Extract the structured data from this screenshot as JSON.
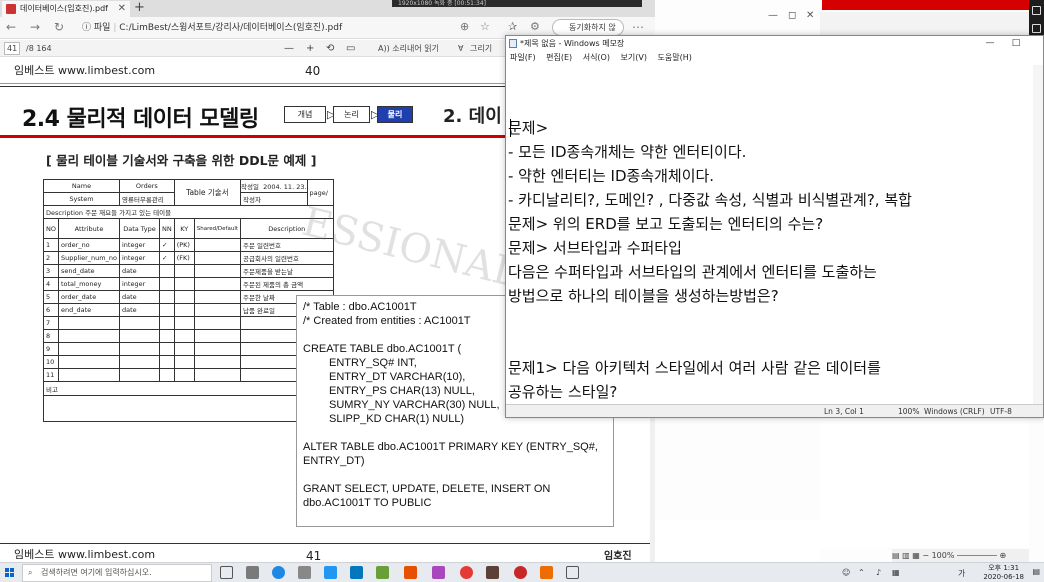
{
  "pdf": {
    "tab_title": "데이터베이스(임호진).pdf",
    "new_tab": "+",
    "url_label": "파일",
    "url": "C:/LimBest/스윙서포트/강리사/데이터베이스(임호진).pdf",
    "profile": "동기화하지 않음",
    "page_current": "41",
    "page_total": "/8 164",
    "zoom_out": "—",
    "zoom_in": "+",
    "read_aloud": "A)) 소리내어 읽기",
    "draw": "그리기",
    "header_brand": "임베스트 www.limbest.com",
    "page_top_number": "40",
    "heading": "2.4  물리적 데이터 모델링",
    "steps": [
      "개념",
      "논리",
      "물리"
    ],
    "heading_right": "2. 데이",
    "subheading": "[ 물리 테이블 기술서와 구축을 위한 DDL문 예제 ]",
    "table": {
      "meta": {
        "name_label": "Name",
        "name_value": "Orders",
        "system_label": "System",
        "system_value": "영류터무롱관리",
        "table_label": "Table 기술서",
        "author_label": "작성일",
        "date_value": "2004. 11. 23.",
        "page_label": "page/",
        "writer_label": "작성자",
        "desc_label": "Description",
        "desc_value": "주문 재요들 가지고 있는 테이블"
      },
      "headers": [
        "NO",
        "Attribute",
        "Data Type",
        "NN",
        "KY",
        "Shared/Default",
        "Description"
      ],
      "rows": [
        [
          "1",
          "order_no",
          "integer",
          "✓",
          "(PK)",
          "",
          "주문 일련번호"
        ],
        [
          "2",
          "Supplier_num_no",
          "integer",
          "✓",
          "(FK)",
          "",
          "공급회사의 일련번호"
        ],
        [
          "3",
          "send_date",
          "date",
          "",
          "",
          "",
          "주문제품을 받는날"
        ],
        [
          "4",
          "total_money",
          "integer",
          "",
          "",
          "",
          "주문된 제품의 총 금액"
        ],
        [
          "5",
          "order_date",
          "date",
          "",
          "",
          "",
          "주문한 날짜"
        ],
        [
          "6",
          "end_date",
          "date",
          "",
          "",
          "",
          "납품 완료일"
        ],
        [
          "7",
          "",
          "",
          "",
          "",
          "",
          ""
        ],
        [
          "8",
          "",
          "",
          "",
          "",
          "",
          ""
        ],
        [
          "9",
          "",
          "",
          "",
          "",
          "",
          ""
        ],
        [
          "10",
          "",
          "",
          "",
          "",
          "",
          ""
        ],
        [
          "11",
          "",
          "",
          "",
          "",
          "",
          ""
        ]
      ],
      "remark_label": "비고"
    },
    "watermark": "ESSIONAL",
    "code_lines": [
      "/*                           Table : dbo.AC1001T",
      "/* Created from entities : AC1001T",
      "",
      "CREATE TABLE dbo.AC1001T (",
      "ENTRY_SQ# INT,",
      "ENTRY_DT VARCHAR(10),",
      "ENTRY_PS CHAR(13) NULL,",
      "SUMRY_NY VARCHAR(30) NULL,",
      "SLIPP_KD CHAR(1) NULL)",
      "",
      "ALTER TABLE dbo.AC1001T PRIMARY KEY (ENTRY_SQ#,",
      "ENTRY_DT)",
      "",
      "GRANT SELECT, UPDATE, DELETE, INSERT ON",
      "dbo.AC1001T TO PUBLIC"
    ],
    "footer_brand": "임베스트 www.limbest.com",
    "footer_page": "41",
    "footer_author": "임호진"
  },
  "notepad": {
    "title": "*제목 없음 - Windows 메모장",
    "minimize": "—",
    "maximize": "□",
    "menu": [
      "파일(F)",
      "편집(E)",
      "서식(O)",
      "보기(V)",
      "도움말(H)"
    ],
    "lines": [
      "문제>",
      "- 모든 ID종속개체는 약한 엔터티이다.",
      "- 약한 엔터티는 ID종속개체이다.",
      "- 카디날리티?, 도메인? , 다중값 속성, 식별과 비식별관계?, 복합",
      "문제> 위의 ERD를 보고 도출되는 엔터티의 수는?",
      "문제> 서브타입과 수퍼타입",
      "다음은 수퍼타입과 서브타입의 관계에서 엔터티를 도출하는",
      "방법으로 하나의 테이블을 생성하는방법은?",
      "",
      "",
      "문제1> 다음 아키텍처 스타일에서 여러 사람 같은 데이터를",
      "공유하는 스타일?"
    ],
    "status_pos": "Ln 3, Col 1",
    "status_zoom": "100%",
    "status_eol": "Windows (CRLF)",
    "status_enc": "UTF-8"
  },
  "overlay": {
    "text": "1920x1080        녹화 중 [00:51:34]"
  },
  "right_bg": {
    "status": "100%"
  },
  "taskbar": {
    "search_placeholder": "검색하려면 여기에 입력하십시오.",
    "time": "오후 1:31",
    "date": "2020-06-18",
    "ime": "가"
  },
  "colors": {
    "accent_red": "#cc0000",
    "step_active": "#1f3fae"
  }
}
